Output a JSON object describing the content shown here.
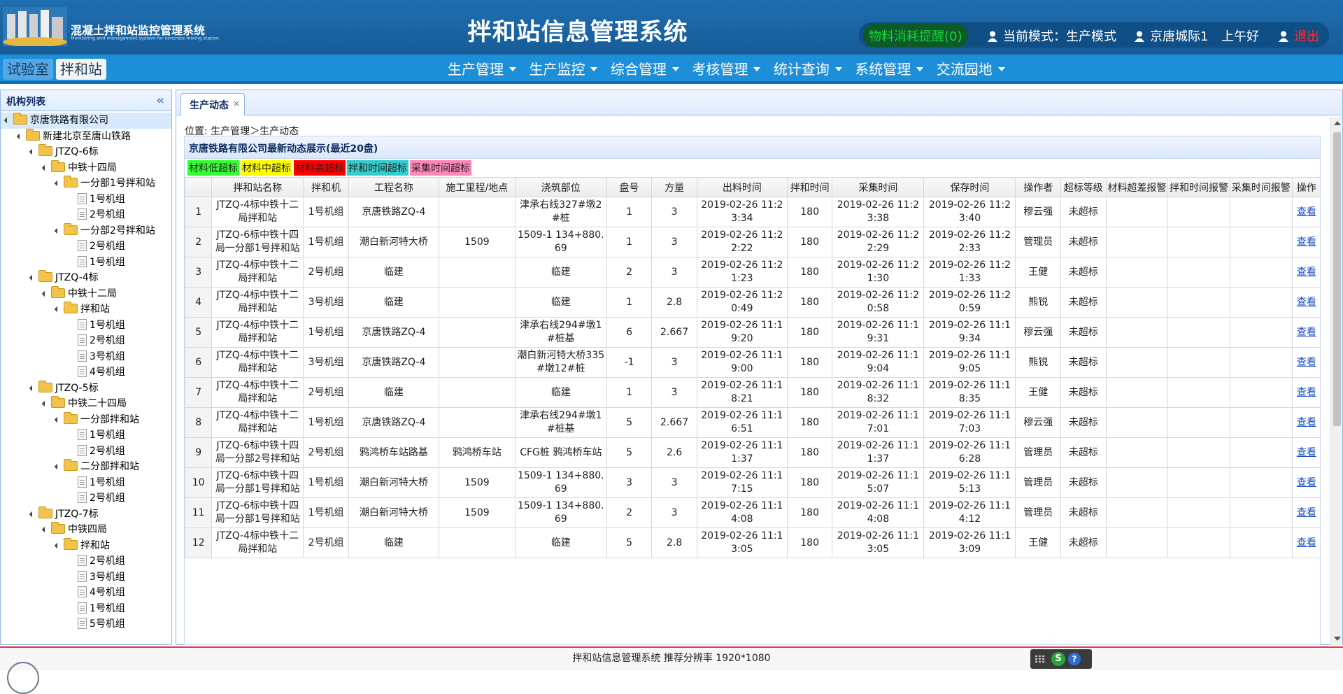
{
  "header": {
    "logo_title": "混凝土拌和站监控管理系统",
    "logo_subtitle": "Monitoring and management system for concrete mixing station",
    "system_title": "拌和站信息管理系统",
    "alert_text": "物料消耗提醒(0)",
    "mode_text": "当前模式：生产模式",
    "user_text": "京唐城际1",
    "greeting": "上午好",
    "logout_text": "退出"
  },
  "nav": {
    "mode_tabs": [
      "试验室",
      "拌和站"
    ],
    "menu": [
      "生产管理",
      "生产监控",
      "综合管理",
      "考核管理",
      "统计查询",
      "系统管理",
      "交流园地"
    ]
  },
  "sidebar": {
    "title": "机构列表",
    "collapse_icon": "«",
    "tree": [
      {
        "label": "京唐铁路有限公司",
        "level": 0,
        "type": "folder",
        "selected": true
      },
      {
        "label": "新建北京至唐山铁路",
        "level": 1,
        "type": "folder"
      },
      {
        "label": "JTZQ-6标",
        "level": 2,
        "type": "folder"
      },
      {
        "label": "中铁十四局",
        "level": 3,
        "type": "folder"
      },
      {
        "label": "一分部1号拌和站",
        "level": 4,
        "type": "folder"
      },
      {
        "label": "1号机组",
        "level": 5,
        "type": "leaf"
      },
      {
        "label": "2号机组",
        "level": 5,
        "type": "leaf"
      },
      {
        "label": "一分部2号拌和站",
        "level": 4,
        "type": "folder"
      },
      {
        "label": "2号机组",
        "level": 5,
        "type": "leaf"
      },
      {
        "label": "1号机组",
        "level": 5,
        "type": "leaf"
      },
      {
        "label": "JTZQ-4标",
        "level": 2,
        "type": "folder"
      },
      {
        "label": "中铁十二局",
        "level": 3,
        "type": "folder"
      },
      {
        "label": "拌和站",
        "level": 4,
        "type": "folder"
      },
      {
        "label": "1号机组",
        "level": 5,
        "type": "leaf"
      },
      {
        "label": "2号机组",
        "level": 5,
        "type": "leaf"
      },
      {
        "label": "3号机组",
        "level": 5,
        "type": "leaf"
      },
      {
        "label": "4号机组",
        "level": 5,
        "type": "leaf"
      },
      {
        "label": "JTZQ-5标",
        "level": 2,
        "type": "folder"
      },
      {
        "label": "中铁二十四局",
        "level": 3,
        "type": "folder"
      },
      {
        "label": "一分部拌和站",
        "level": 4,
        "type": "folder"
      },
      {
        "label": "1号机组",
        "level": 5,
        "type": "leaf"
      },
      {
        "label": "2号机组",
        "level": 5,
        "type": "leaf"
      },
      {
        "label": "二分部拌和站",
        "level": 4,
        "type": "folder"
      },
      {
        "label": "1号机组",
        "level": 5,
        "type": "leaf"
      },
      {
        "label": "2号机组",
        "level": 5,
        "type": "leaf"
      },
      {
        "label": "JTZQ-7标",
        "level": 2,
        "type": "folder"
      },
      {
        "label": "中铁四局",
        "level": 3,
        "type": "folder"
      },
      {
        "label": "拌和站",
        "level": 4,
        "type": "folder"
      },
      {
        "label": "2号机组",
        "level": 5,
        "type": "leaf"
      },
      {
        "label": "3号机组",
        "level": 5,
        "type": "leaf"
      },
      {
        "label": "4号机组",
        "level": 5,
        "type": "leaf"
      },
      {
        "label": "1号机组",
        "level": 5,
        "type": "leaf"
      },
      {
        "label": "5号机组",
        "level": 5,
        "type": "leaf"
      }
    ]
  },
  "main": {
    "tab_label": "生产动态",
    "tab_close": "×",
    "breadcrumb": "位置: 生产管理＞生产动态",
    "panel_title": "京唐铁路有限公司最新动态展示(最近20盘)",
    "legend": [
      {
        "label": "材料低超标",
        "color": "#33ff33"
      },
      {
        "label": "材料中超标",
        "color": "#ffff00"
      },
      {
        "label": "材料高超标",
        "color": "#ff0000"
      },
      {
        "label": "拌和时间超标",
        "color": "#33cccc"
      },
      {
        "label": "采集时间超标",
        "color": "#ff88bb"
      }
    ],
    "columns": [
      "",
      "拌和站名称",
      "拌和机",
      "工程名称",
      "施工里程/地点",
      "浇筑部位",
      "盘号",
      "方量",
      "出料时间",
      "拌和时间",
      "采集时间",
      "保存时间",
      "操作者",
      "超标等级",
      "材料超差报警",
      "拌和时间报警",
      "采集时间报警",
      "操作"
    ],
    "view_label": "查看",
    "rows": [
      [
        "1",
        "JTZQ-4标中铁十二局拌和站",
        "1号机组",
        "京唐铁路ZQ-4",
        "",
        "津承右线327#墩2#桩",
        "1",
        "3",
        "2019-02-26 11:23:34",
        "180",
        "2019-02-26 11:23:38",
        "2019-02-26 11:23:40",
        "穆云强",
        "未超标"
      ],
      [
        "2",
        "JTZQ-6标中铁十四局一分部1号拌和站",
        "1号机组",
        "潮白新河特大桥",
        "1509",
        "1509-1 134+880.69",
        "1",
        "3",
        "2019-02-26 11:22:22",
        "180",
        "2019-02-26 11:22:29",
        "2019-02-26 11:22:33",
        "管理员",
        "未超标"
      ],
      [
        "3",
        "JTZQ-4标中铁十二局拌和站",
        "2号机组",
        "临建",
        "",
        "临建",
        "2",
        "3",
        "2019-02-26 11:21:23",
        "180",
        "2019-02-26 11:21:30",
        "2019-02-26 11:21:33",
        "王健",
        "未超标"
      ],
      [
        "4",
        "JTZQ-4标中铁十二局拌和站",
        "3号机组",
        "临建",
        "",
        "临建",
        "1",
        "2.8",
        "2019-02-26 11:20:49",
        "180",
        "2019-02-26 11:20:58",
        "2019-02-26 11:20:59",
        "熊锐",
        "未超标"
      ],
      [
        "5",
        "JTZQ-4标中铁十二局拌和站",
        "1号机组",
        "京唐铁路ZQ-4",
        "",
        "津承右线294#墩1#桩基",
        "6",
        "2.667",
        "2019-02-26 11:19:20",
        "180",
        "2019-02-26 11:19:31",
        "2019-02-26 11:19:34",
        "穆云强",
        "未超标"
      ],
      [
        "6",
        "JTZQ-4标中铁十二局拌和站",
        "3号机组",
        "京唐铁路ZQ-4",
        "",
        "潮白新河特大桥335#墩12#桩",
        "-1",
        "3",
        "2019-02-26 11:19:00",
        "180",
        "2019-02-26 11:19:04",
        "2019-02-26 11:19:05",
        "熊锐",
        "未超标"
      ],
      [
        "7",
        "JTZQ-4标中铁十二局拌和站",
        "2号机组",
        "临建",
        "",
        "临建",
        "1",
        "3",
        "2019-02-26 11:18:21",
        "180",
        "2019-02-26 11:18:32",
        "2019-02-26 11:18:35",
        "王健",
        "未超标"
      ],
      [
        "8",
        "JTZQ-4标中铁十二局拌和站",
        "1号机组",
        "京唐铁路ZQ-4",
        "",
        "津承右线294#墩1#桩基",
        "5",
        "2.667",
        "2019-02-26 11:16:51",
        "180",
        "2019-02-26 11:17:01",
        "2019-02-26 11:17:03",
        "穆云强",
        "未超标"
      ],
      [
        "9",
        "JTZQ-6标中铁十四局一分部2号拌和站",
        "2号机组",
        "鸦鸿桥车站路基",
        "鸦鸿桥车站",
        "CFG桩 鸦鸿桥车站",
        "5",
        "2.6",
        "2019-02-26 11:11:37",
        "180",
        "2019-02-26 11:11:37",
        "2019-02-26 11:16:28",
        "管理员",
        "未超标"
      ],
      [
        "10",
        "JTZQ-6标中铁十四局一分部1号拌和站",
        "1号机组",
        "潮白新河特大桥",
        "1509",
        "1509-1 134+880.69",
        "3",
        "3",
        "2019-02-26 11:17:15",
        "180",
        "2019-02-26 11:15:07",
        "2019-02-26 11:15:13",
        "管理员",
        "未超标"
      ],
      [
        "11",
        "JTZQ-6标中铁十四局一分部1号拌和站",
        "1号机组",
        "潮白新河特大桥",
        "1509",
        "1509-1 134+880.69",
        "2",
        "3",
        "2019-02-26 11:14:08",
        "180",
        "2019-02-26 11:14:08",
        "2019-02-26 11:14:12",
        "管理员",
        "未超标"
      ],
      [
        "12",
        "JTZQ-4标中铁十二局拌和站",
        "2号机组",
        "临建",
        "",
        "临建",
        "5",
        "2.8",
        "2019-02-26 11:13:05",
        "180",
        "2019-02-26 11:13:05",
        "2019-02-26 11:13:09",
        "王健",
        "未超标"
      ]
    ]
  },
  "footer": {
    "text": "拌和站信息管理系统 推荐分辨率 1920*1080",
    "tray_icons": [
      "grip-icon",
      "sogou-icon",
      "help-icon"
    ]
  }
}
